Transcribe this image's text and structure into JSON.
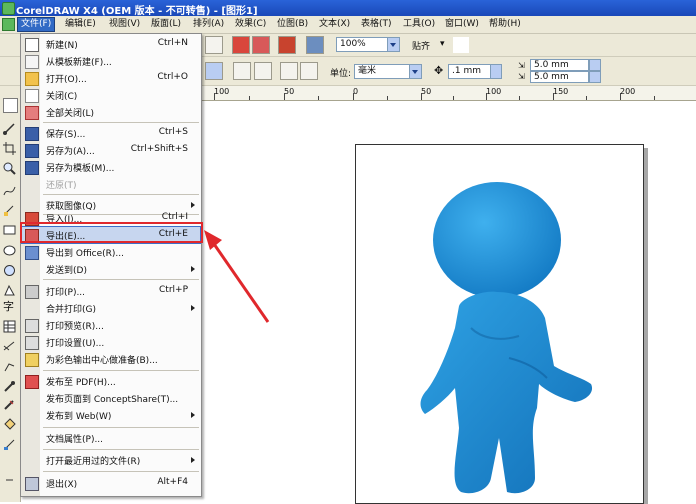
{
  "window": {
    "title": "CorelDRAW X4 (OEM 版本 - 不可转售) - [图形1]"
  },
  "menubar": [
    {
      "label": "文件(F)",
      "active": true
    },
    {
      "label": "编辑(E)"
    },
    {
      "label": "视图(V)"
    },
    {
      "label": "版面(L)"
    },
    {
      "label": "排列(A)"
    },
    {
      "label": "效果(C)"
    },
    {
      "label": "位图(B)"
    },
    {
      "label": "文本(X)"
    },
    {
      "label": "表格(T)"
    },
    {
      "label": "工具(O)"
    },
    {
      "label": "窗口(W)"
    },
    {
      "label": "帮助(H)"
    }
  ],
  "toolbar": {
    "zoom_value": "100%",
    "snap_label": "贴齐",
    "units_label": "单位:",
    "units_value": "毫米",
    "nudge_value": ".1 mm",
    "dup_x": "5.0 mm",
    "dup_y": "5.0 mm"
  },
  "ruler": {
    "labels": [
      "100",
      "50",
      "0",
      "50",
      "100",
      "150",
      "200"
    ]
  },
  "file_menu": {
    "items": [
      {
        "label": "新建(N)",
        "shortcut": "Ctrl+N",
        "icon": "new-document-icon"
      },
      {
        "label": "从模板新建(F)...",
        "shortcut": "",
        "icon": "template-icon"
      },
      {
        "label": "打开(O)...",
        "shortcut": "Ctrl+O",
        "icon": "open-folder-icon"
      },
      {
        "label": "关闭(C)",
        "shortcut": "",
        "icon": "close-doc-icon"
      },
      {
        "label": "全部关闭(L)",
        "shortcut": "",
        "icon": "close-all-icon"
      },
      {
        "label": "保存(S)...",
        "shortcut": "Ctrl+S",
        "icon": "save-icon"
      },
      {
        "label": "另存为(A)...",
        "shortcut": "Ctrl+Shift+S",
        "icon": "save-as-icon"
      },
      {
        "label": "另存为模板(M)...",
        "shortcut": "",
        "icon": "save-template-icon"
      },
      {
        "label": "还原(T)",
        "shortcut": "",
        "icon": "",
        "disabled": true
      },
      {
        "label": "获取图像(Q)",
        "shortcut": "",
        "icon": "",
        "submenu": true
      },
      {
        "label": "导入(I)...",
        "shortcut": "Ctrl+I",
        "icon": "import-icon"
      },
      {
        "label": "导出(E)...",
        "shortcut": "Ctrl+E",
        "icon": "export-icon",
        "highlight": true
      },
      {
        "label": "导出到 Office(R)...",
        "shortcut": "",
        "icon": "export-office-icon"
      },
      {
        "label": "发送到(D)",
        "shortcut": "",
        "icon": "",
        "submenu": true
      },
      {
        "label": "打印(P)...",
        "shortcut": "Ctrl+P",
        "icon": "print-icon"
      },
      {
        "label": "合并打印(G)",
        "shortcut": "",
        "icon": "",
        "submenu": true
      },
      {
        "label": "打印预览(R)...",
        "shortcut": "",
        "icon": "print-preview-icon"
      },
      {
        "label": "打印设置(U)...",
        "shortcut": "",
        "icon": "print-setup-icon"
      },
      {
        "label": "为彩色输出中心做准备(B)...",
        "shortcut": "",
        "icon": "prepare-output-icon"
      },
      {
        "label": "发布至 PDF(H)...",
        "shortcut": "",
        "icon": "pdf-icon"
      },
      {
        "label": "发布页面到 ConceptShare(T)...",
        "shortcut": "",
        "icon": "conceptshare-icon"
      },
      {
        "label": "发布到 Web(W)",
        "shortcut": "",
        "icon": "",
        "submenu": true
      },
      {
        "label": "文档属性(P)...",
        "shortcut": "",
        "icon": ""
      },
      {
        "label": "打开最近用过的文件(R)",
        "shortcut": "",
        "icon": "",
        "submenu": true
      },
      {
        "label": "退出(X)",
        "shortcut": "Alt+F4",
        "icon": "exit-icon"
      }
    ]
  },
  "colors": {
    "titlebar": "#1f55c8",
    "figure": "#1e8fd6",
    "highlight_box": "#e0282c",
    "arrow": "#e0282c"
  }
}
